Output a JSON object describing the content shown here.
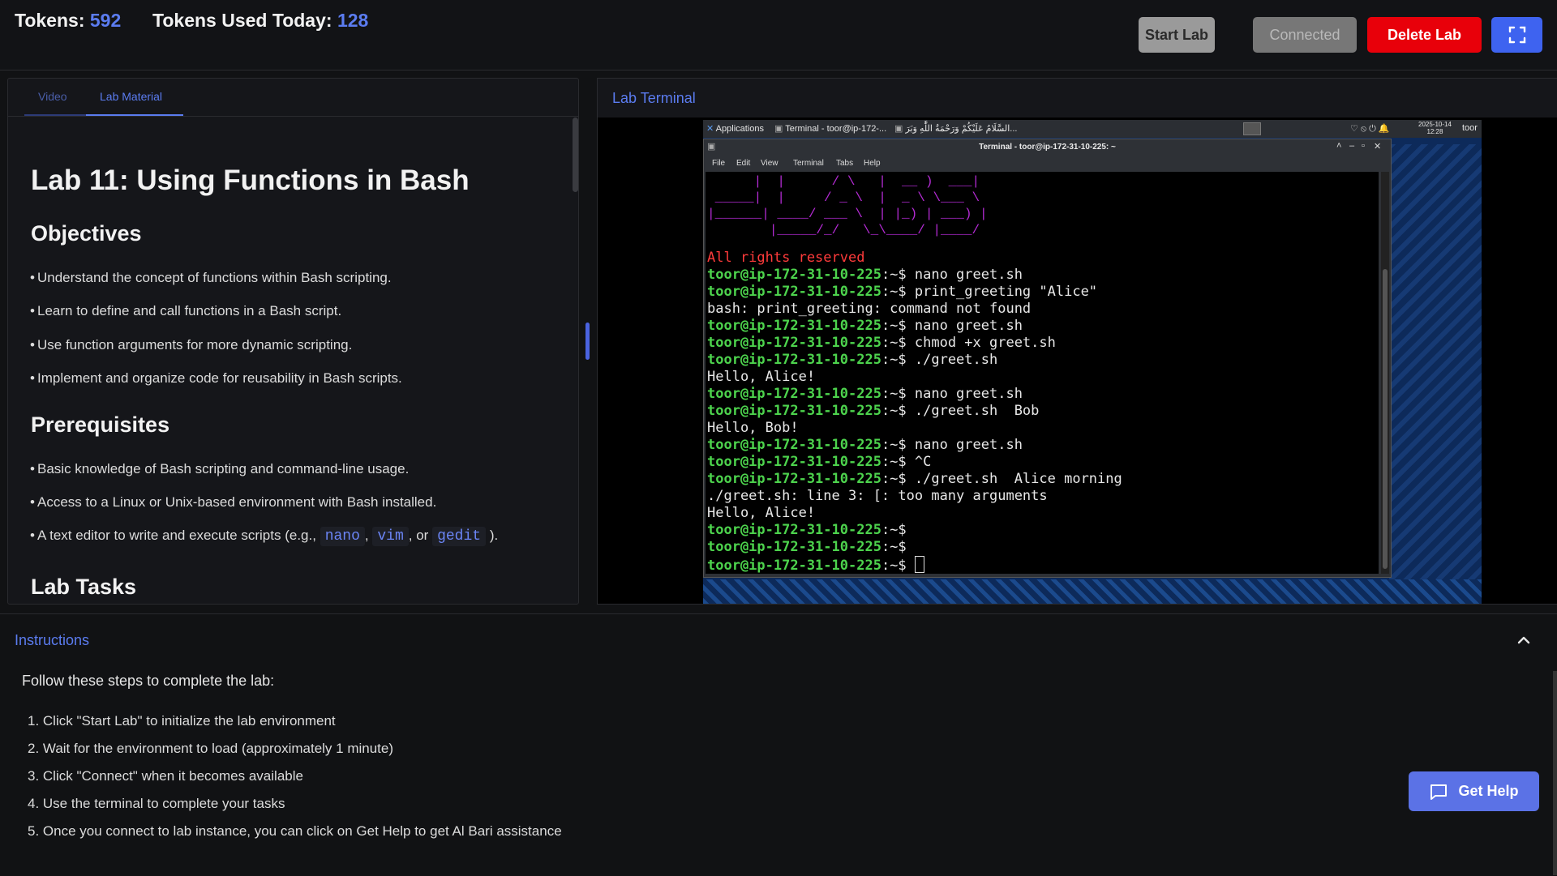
{
  "header": {
    "tokens_label": "Tokens:",
    "tokens_value": "592",
    "used_label": "Tokens Used Today:",
    "used_value": "128",
    "buttons": {
      "start": "Start Lab",
      "connected": "Connected",
      "delete": "Delete Lab",
      "fullscreen_icon": "fullscreen-icon"
    }
  },
  "left": {
    "tabs": [
      "Video",
      "Lab Material"
    ],
    "active_tab": "Lab Material",
    "title": "Lab 11: Using Functions in Bash",
    "objectives_heading": "Objectives",
    "objectives": [
      "Understand the concept of functions within Bash scripting.",
      "Learn to define and call functions in a Bash script.",
      "Use function arguments for more dynamic scripting.",
      "Implement and organize code for reusability in Bash scripts."
    ],
    "prereq_heading": "Prerequisites",
    "prereqs": [
      "Basic knowledge of Bash scripting and command-line usage.",
      "Access to a Linux or Unix-based environment with Bash installed."
    ],
    "prereq_editor": {
      "before": "A text editor to write and execute scripts (e.g.,",
      "code1": "nano",
      "sep1": ",",
      "code2": "vim",
      "sep2": ", or",
      "code3": "gedit",
      "after": ")."
    },
    "tasks_heading": "Lab Tasks"
  },
  "terminal": {
    "title": "Lab Terminal",
    "panel": {
      "applications": "Applications",
      "task": "Terminal - toor@ip-172-...",
      "task2": "السَّلَامُ عَلَيْكُمْ وَرَحْمَةُ اللَّٰهِ وَبَرَ...",
      "date": "2025-10-14",
      "time": "12:28",
      "user": "toor"
    },
    "window_title": "Terminal - toor@ip-172-31-10-225: ~",
    "menu": [
      "File",
      "Edit",
      "View",
      "Terminal",
      "Tabs",
      "Help"
    ],
    "rights": "All rights reserved",
    "prompt": "toor@ip-172-31-10-225:~$",
    "lines": [
      {
        "type": "cmd",
        "text": " nano greet.sh"
      },
      {
        "type": "cmd",
        "text": " print_greeting \"Alice\""
      },
      {
        "type": "out",
        "text": "bash: print_greeting: command not found"
      },
      {
        "type": "cmd",
        "text": " nano greet.sh"
      },
      {
        "type": "cmd",
        "text": " chmod +x greet.sh"
      },
      {
        "type": "cmd",
        "text": " ./greet.sh"
      },
      {
        "type": "out",
        "text": "Hello, Alice!"
      },
      {
        "type": "cmd",
        "text": " nano greet.sh"
      },
      {
        "type": "cmd",
        "text": " ./greet.sh  Bob"
      },
      {
        "type": "out",
        "text": "Hello, Bob!"
      },
      {
        "type": "cmd",
        "text": " nano greet.sh"
      },
      {
        "type": "cmd",
        "text": " ^C"
      },
      {
        "type": "cmd",
        "text": " ./greet.sh  Alice morning"
      },
      {
        "type": "out",
        "text": "./greet.sh: line 3: [: too many arguments"
      },
      {
        "type": "out",
        "text": "Hello, Alice!"
      },
      {
        "type": "cmd",
        "text": ""
      },
      {
        "type": "cmd",
        "text": ""
      },
      {
        "type": "cmd",
        "text": " "
      }
    ]
  },
  "instructions": {
    "title": "Instructions",
    "intro": "Follow these steps to complete the lab:",
    "steps": [
      "1. Click \"Start Lab\" to initialize the lab environment",
      "2. Wait for the environment to load (approximately 1 minute)",
      "3. Click \"Connect\" when it becomes available",
      "4. Use the terminal to complete your tasks",
      "5. Once you connect to lab instance, you can click on Get Help to get Al Bari assistance"
    ],
    "get_help": "Get Help"
  },
  "colors": {
    "accent": "#5b7cf0",
    "danger": "#e8000a",
    "prompt_green": "#4dd34d"
  }
}
